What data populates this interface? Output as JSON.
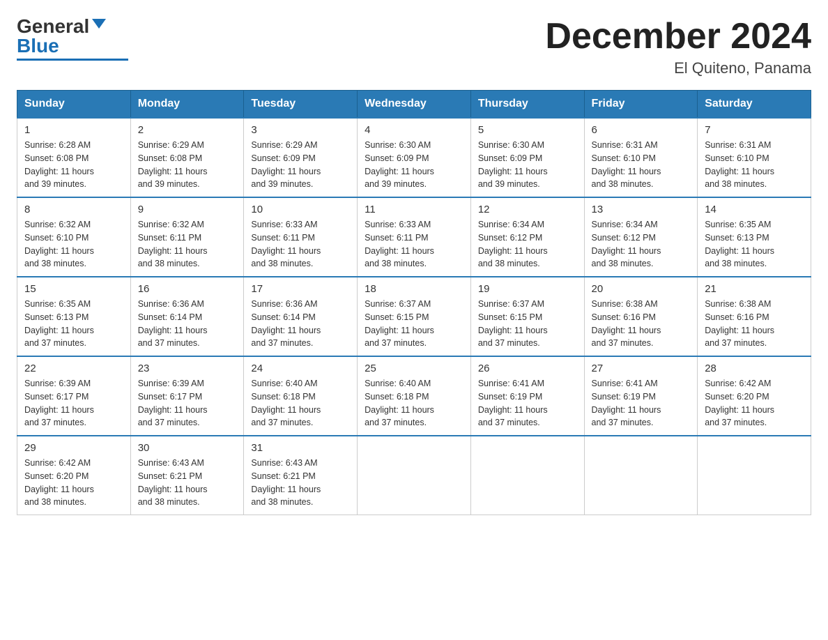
{
  "logo": {
    "general": "General",
    "blue": "Blue"
  },
  "title": {
    "month": "December 2024",
    "location": "El Quiteno, Panama"
  },
  "headers": [
    "Sunday",
    "Monday",
    "Tuesday",
    "Wednesday",
    "Thursday",
    "Friday",
    "Saturday"
  ],
  "weeks": [
    [
      {
        "day": "1",
        "sunrise": "6:28 AM",
        "sunset": "6:08 PM",
        "daylight": "11 hours and 39 minutes."
      },
      {
        "day": "2",
        "sunrise": "6:29 AM",
        "sunset": "6:08 PM",
        "daylight": "11 hours and 39 minutes."
      },
      {
        "day": "3",
        "sunrise": "6:29 AM",
        "sunset": "6:09 PM",
        "daylight": "11 hours and 39 minutes."
      },
      {
        "day": "4",
        "sunrise": "6:30 AM",
        "sunset": "6:09 PM",
        "daylight": "11 hours and 39 minutes."
      },
      {
        "day": "5",
        "sunrise": "6:30 AM",
        "sunset": "6:09 PM",
        "daylight": "11 hours and 39 minutes."
      },
      {
        "day": "6",
        "sunrise": "6:31 AM",
        "sunset": "6:10 PM",
        "daylight": "11 hours and 38 minutes."
      },
      {
        "day": "7",
        "sunrise": "6:31 AM",
        "sunset": "6:10 PM",
        "daylight": "11 hours and 38 minutes."
      }
    ],
    [
      {
        "day": "8",
        "sunrise": "6:32 AM",
        "sunset": "6:10 PM",
        "daylight": "11 hours and 38 minutes."
      },
      {
        "day": "9",
        "sunrise": "6:32 AM",
        "sunset": "6:11 PM",
        "daylight": "11 hours and 38 minutes."
      },
      {
        "day": "10",
        "sunrise": "6:33 AM",
        "sunset": "6:11 PM",
        "daylight": "11 hours and 38 minutes."
      },
      {
        "day": "11",
        "sunrise": "6:33 AM",
        "sunset": "6:11 PM",
        "daylight": "11 hours and 38 minutes."
      },
      {
        "day": "12",
        "sunrise": "6:34 AM",
        "sunset": "6:12 PM",
        "daylight": "11 hours and 38 minutes."
      },
      {
        "day": "13",
        "sunrise": "6:34 AM",
        "sunset": "6:12 PM",
        "daylight": "11 hours and 38 minutes."
      },
      {
        "day": "14",
        "sunrise": "6:35 AM",
        "sunset": "6:13 PM",
        "daylight": "11 hours and 38 minutes."
      }
    ],
    [
      {
        "day": "15",
        "sunrise": "6:35 AM",
        "sunset": "6:13 PM",
        "daylight": "11 hours and 37 minutes."
      },
      {
        "day": "16",
        "sunrise": "6:36 AM",
        "sunset": "6:14 PM",
        "daylight": "11 hours and 37 minutes."
      },
      {
        "day": "17",
        "sunrise": "6:36 AM",
        "sunset": "6:14 PM",
        "daylight": "11 hours and 37 minutes."
      },
      {
        "day": "18",
        "sunrise": "6:37 AM",
        "sunset": "6:15 PM",
        "daylight": "11 hours and 37 minutes."
      },
      {
        "day": "19",
        "sunrise": "6:37 AM",
        "sunset": "6:15 PM",
        "daylight": "11 hours and 37 minutes."
      },
      {
        "day": "20",
        "sunrise": "6:38 AM",
        "sunset": "6:16 PM",
        "daylight": "11 hours and 37 minutes."
      },
      {
        "day": "21",
        "sunrise": "6:38 AM",
        "sunset": "6:16 PM",
        "daylight": "11 hours and 37 minutes."
      }
    ],
    [
      {
        "day": "22",
        "sunrise": "6:39 AM",
        "sunset": "6:17 PM",
        "daylight": "11 hours and 37 minutes."
      },
      {
        "day": "23",
        "sunrise": "6:39 AM",
        "sunset": "6:17 PM",
        "daylight": "11 hours and 37 minutes."
      },
      {
        "day": "24",
        "sunrise": "6:40 AM",
        "sunset": "6:18 PM",
        "daylight": "11 hours and 37 minutes."
      },
      {
        "day": "25",
        "sunrise": "6:40 AM",
        "sunset": "6:18 PM",
        "daylight": "11 hours and 37 minutes."
      },
      {
        "day": "26",
        "sunrise": "6:41 AM",
        "sunset": "6:19 PM",
        "daylight": "11 hours and 37 minutes."
      },
      {
        "day": "27",
        "sunrise": "6:41 AM",
        "sunset": "6:19 PM",
        "daylight": "11 hours and 37 minutes."
      },
      {
        "day": "28",
        "sunrise": "6:42 AM",
        "sunset": "6:20 PM",
        "daylight": "11 hours and 37 minutes."
      }
    ],
    [
      {
        "day": "29",
        "sunrise": "6:42 AM",
        "sunset": "6:20 PM",
        "daylight": "11 hours and 38 minutes."
      },
      {
        "day": "30",
        "sunrise": "6:43 AM",
        "sunset": "6:21 PM",
        "daylight": "11 hours and 38 minutes."
      },
      {
        "day": "31",
        "sunrise": "6:43 AM",
        "sunset": "6:21 PM",
        "daylight": "11 hours and 38 minutes."
      },
      null,
      null,
      null,
      null
    ]
  ],
  "labels": {
    "sunrise": "Sunrise:",
    "sunset": "Sunset:",
    "daylight": "Daylight:"
  }
}
